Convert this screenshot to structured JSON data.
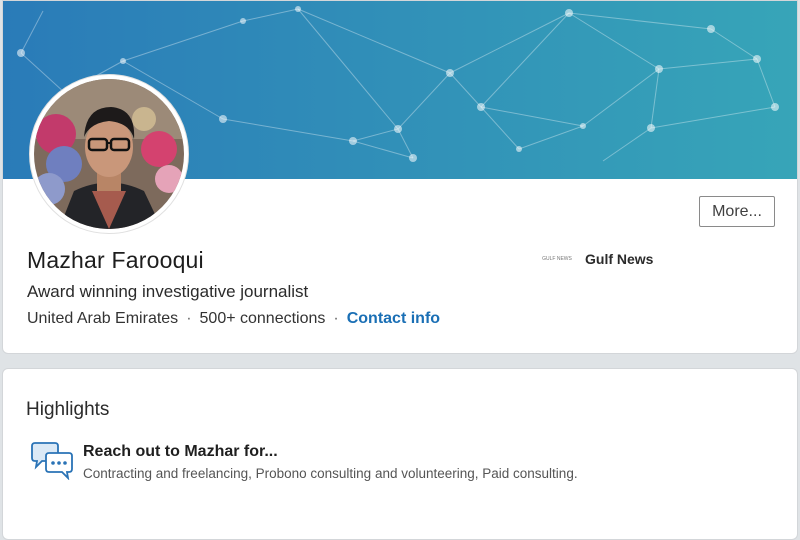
{
  "profile": {
    "name": "Mazhar Farooqui",
    "headline": "Award winning investigative journalist",
    "location": "United Arab Emirates",
    "connections": "500+ connections",
    "contact_link": "Contact info",
    "separator": "·",
    "more_button": "More...",
    "employer": {
      "name": "Gulf News",
      "logo_text": "GULF NEWS"
    }
  },
  "highlights": {
    "title": "Highlights",
    "item": {
      "heading": "Reach out to Mazhar for...",
      "description": "Contracting and freelancing, Probono consulting and volunteering, Paid consulting."
    }
  },
  "colors": {
    "link": "#1a6fb5",
    "banner_start": "#2a7bb8",
    "banner_end": "#37a5b8"
  },
  "icons": {
    "highlight": "chat-bubbles-icon",
    "avatar": "profile-photo"
  }
}
